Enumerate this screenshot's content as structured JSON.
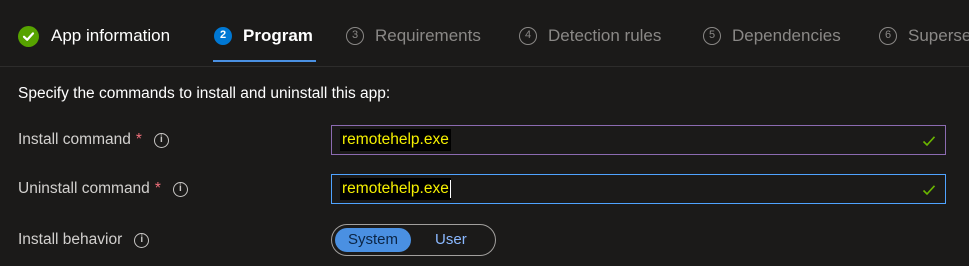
{
  "tabs": [
    {
      "label": "App information",
      "state": "done",
      "icon": "check-icon"
    },
    {
      "number": "2",
      "label": "Program",
      "state": "active"
    },
    {
      "number": "3",
      "label": "Requirements",
      "state": "pending"
    },
    {
      "number": "4",
      "label": "Detection rules",
      "state": "pending"
    },
    {
      "number": "5",
      "label": "Dependencies",
      "state": "pending"
    },
    {
      "number": "6",
      "label": "Superse",
      "state": "pending"
    }
  ],
  "form": {
    "heading": "Specify the commands to install and uninstall this app:",
    "required_marker": "*",
    "info_glyph": "i",
    "install_command": {
      "label": "Install command",
      "value": "remotehelp.exe",
      "valid": true
    },
    "uninstall_command": {
      "label": "Uninstall command",
      "value": "remotehelp.exe",
      "valid": true
    },
    "install_behavior": {
      "label": "Install behavior",
      "options": [
        "System",
        "User"
      ],
      "selected": "System"
    }
  },
  "colors": {
    "background": "#1b1a19",
    "accent": "#0078d4",
    "success": "#57a300",
    "required": "#f1707b",
    "highlight_text": "#f5f000"
  }
}
